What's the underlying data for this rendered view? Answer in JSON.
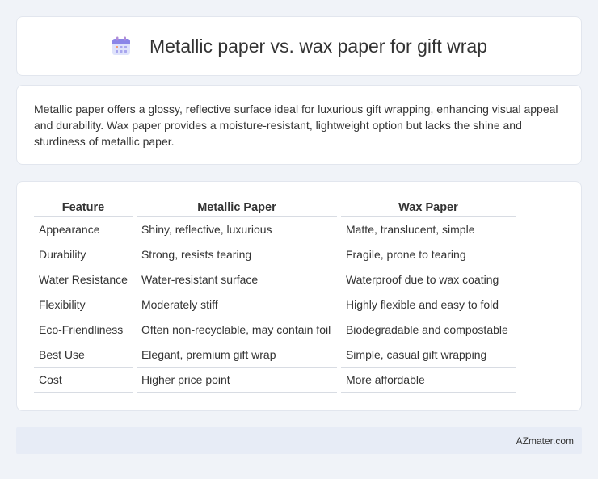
{
  "header": {
    "title": "Metallic paper vs. wax paper for gift wrap",
    "icon": "calendar-icon"
  },
  "summary": {
    "text": "Metallic paper offers a glossy, reflective surface ideal for luxurious gift wrapping, enhancing visual appeal and durability. Wax paper provides a moisture-resistant, lightweight option but lacks the shine and sturdiness of metallic paper."
  },
  "table": {
    "headers": [
      "Feature",
      "Metallic Paper",
      "Wax Paper"
    ],
    "rows": [
      [
        "Appearance",
        "Shiny, reflective, luxurious",
        "Matte, translucent, simple"
      ],
      [
        "Durability",
        "Strong, resists tearing",
        "Fragile, prone to tearing"
      ],
      [
        "Water Resistance",
        "Water-resistant surface",
        "Waterproof due to wax coating"
      ],
      [
        "Flexibility",
        "Moderately stiff",
        "Highly flexible and easy to fold"
      ],
      [
        "Eco-Friendliness",
        "Often non-recyclable, may contain foil",
        "Biodegradable and compostable"
      ],
      [
        "Best Use",
        "Elegant, premium gift wrap",
        "Simple, casual gift wrapping"
      ],
      [
        "Cost",
        "Higher price point",
        "More affordable"
      ]
    ]
  },
  "footer": {
    "text": "AZmater.com"
  }
}
